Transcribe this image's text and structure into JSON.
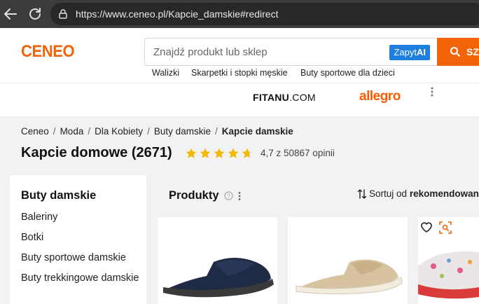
{
  "browser": {
    "url": "https://www.ceneo.pl/Kapcie_damskie#redirect"
  },
  "header": {
    "logo": "CENEO",
    "search_placeholder": "Znajdź produkt lub sklep",
    "zapyt_prefix": "Zapyt",
    "zapyt_suffix": "AI",
    "search_button": "SZ",
    "quick_links": [
      "Walizki",
      "Skarpetki i stopki męskie",
      "Buty sportowe dla dzieci"
    ]
  },
  "ads": {
    "fitanu_bold": "FITANU",
    "fitanu_rest": ".COM",
    "allegro": "allegro"
  },
  "breadcrumb": {
    "items": [
      "Ceneo",
      "Moda",
      "Dla Kobiety",
      "Buty damskie"
    ],
    "separator": "/",
    "current": "Kapcie damskie"
  },
  "page": {
    "title": "Kapcie domowe",
    "count": "(2671)",
    "stars": 4.7,
    "rating_text": "4,7 z 50867 opinii"
  },
  "sidebar": {
    "heading": "Buty damskie",
    "items": [
      "Baleriny",
      "Botki",
      "Buty sportowe damskie",
      "Buty trekkingowe damskie"
    ]
  },
  "products": {
    "title": "Produkty",
    "sort_prefix": "Sortuj od",
    "sort_value": "rekomendowan"
  },
  "colors": {
    "brand_orange": "#f2640a",
    "zapyt_blue": "#1e7fe0",
    "allegro_orange": "#ff5a00",
    "star_yellow": "#f5b800"
  }
}
